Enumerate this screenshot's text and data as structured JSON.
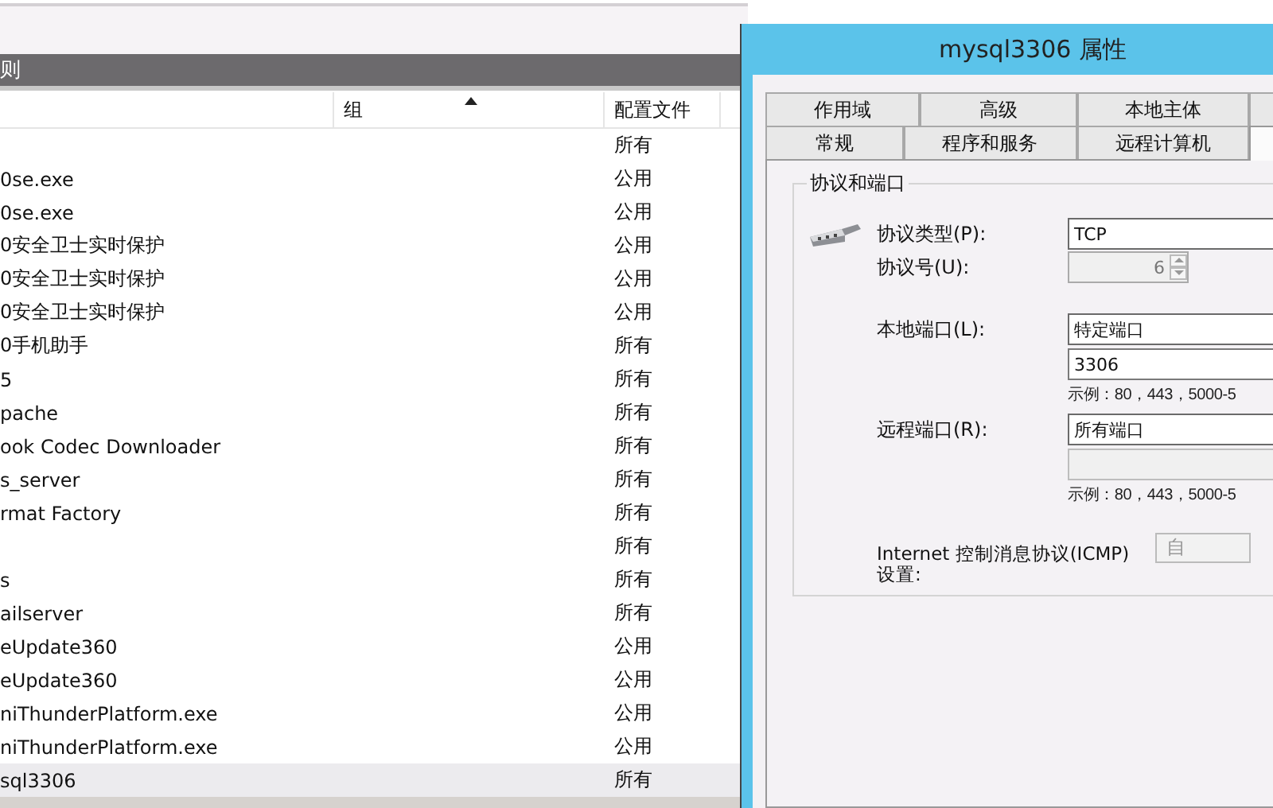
{
  "rules_panel": {
    "title": "则",
    "columns": [
      {},
      {
        "label": "组",
        "sorted": true
      },
      {
        "label": "配置文件"
      }
    ],
    "rows": [
      {
        "profile": "所有",
        "selected": false
      },
      {
        "name": "0se.exe",
        "profile": "公用",
        "selected": false
      },
      {
        "name": "0se.exe",
        "profile": "公用",
        "selected": false
      },
      {
        "name": "0安全卫士实时保护",
        "profile": "公用",
        "selected": false
      },
      {
        "name": "0安全卫士实时保护",
        "profile": "公用",
        "selected": false
      },
      {
        "name": "0安全卫士实时保护",
        "profile": "公用",
        "selected": false
      },
      {
        "name": "0手机助手",
        "profile": "所有",
        "selected": false
      },
      {
        "name": "5",
        "profile": "所有",
        "selected": false
      },
      {
        "name": "pache",
        "profile": "所有",
        "selected": false
      },
      {
        "name": "ook Codec Downloader",
        "profile": "所有",
        "selected": false
      },
      {
        "name": "s_server",
        "profile": "所有",
        "selected": false
      },
      {
        "name": "rmat Factory",
        "profile": "所有",
        "selected": false
      },
      {
        "profile": "所有",
        "selected": false
      },
      {
        "name": "s",
        "profile": "所有",
        "selected": false
      },
      {
        "name": "ailserver",
        "profile": "所有",
        "selected": false
      },
      {
        "name": "eUpdate360",
        "profile": "公用",
        "selected": false
      },
      {
        "name": "eUpdate360",
        "profile": "公用",
        "selected": false
      },
      {
        "name": "niThunderPlatform.exe",
        "profile": "公用",
        "selected": false
      },
      {
        "name": "niThunderPlatform.exe",
        "profile": "公用",
        "selected": false
      },
      {
        "name": "sql3306",
        "profile": "所有",
        "selected": true
      }
    ]
  },
  "dialog": {
    "title": "mysql3306 属性",
    "tab_rows": [
      [
        {
          "label": "作用域",
          "selected": false
        },
        {
          "label": "高级",
          "selected": false
        },
        {
          "label": "本地主体",
          "selected": false
        },
        {
          "selected": false
        }
      ],
      [
        {
          "label": "常规",
          "selected": false
        },
        {
          "label": "程序和服务",
          "selected": false
        },
        {
          "label": "远程计算机",
          "selected": false
        },
        {
          "selected": true
        }
      ]
    ],
    "group_title": "协议和端口",
    "fields": [
      {
        "kind": "dropdown",
        "label": "协议类型(P):",
        "value": "TCP",
        "disabled": false
      },
      {
        "kind": "spinner",
        "label": "协议号(U):",
        "value": "6",
        "disabled": true
      },
      {
        "kind": "dropdown",
        "label": "本地端口(L):",
        "value": "特定端口",
        "disabled": false
      },
      {
        "kind": "input",
        "value": "3306",
        "disabled": false
      },
      {
        "kind": "hint",
        "text": "示例：80，443，5000-5"
      },
      {
        "kind": "dropdown",
        "label": "远程端口(R):",
        "value": "所有端口",
        "disabled": false
      },
      {
        "kind": "input",
        "disabled": true
      },
      {
        "kind": "hint",
        "text": "示例：80，443，5000-5"
      }
    ],
    "icmp_label": "Internet 控制消息协议(ICMP)设置:",
    "icmp_button": {
      "label": "自",
      "disabled": true
    }
  }
}
